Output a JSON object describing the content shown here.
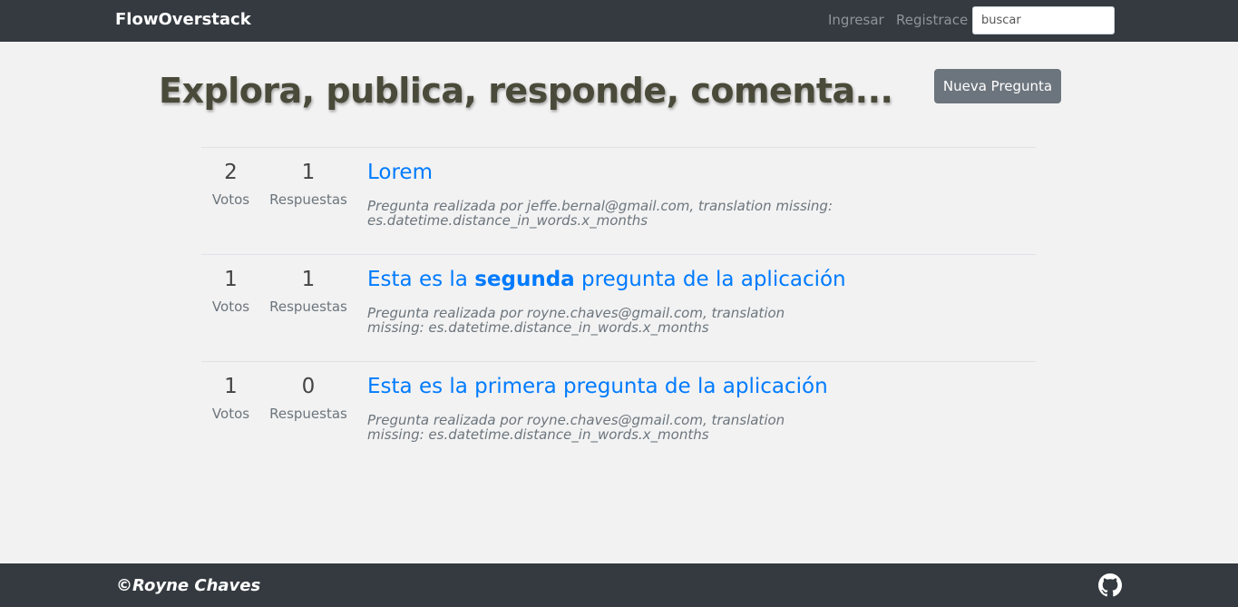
{
  "navbar": {
    "brand": "FlowOverstack",
    "login_label": "Ingresar",
    "register_label": "Registrace",
    "search_placeholder": "buscar"
  },
  "header": {
    "title": "Explora, publica, responde, comenta...",
    "new_question_label": "Nueva Pregunta"
  },
  "stat_labels": {
    "votes": "Votos",
    "answers": "Respuestas"
  },
  "questions": [
    {
      "votes": "2",
      "answers": "1",
      "title_before": "Lorem",
      "title_bold": "",
      "title_after": "",
      "meta": "Pregunta realizada por jeffe.bernal@gmail.com, translation missing: es.datetime.distance_in_words.x_months"
    },
    {
      "votes": "1",
      "answers": "1",
      "title_before": "Esta es la ",
      "title_bold": "segunda",
      "title_after": " pregunta de la aplicación",
      "meta": "Pregunta realizada por royne.chaves@gmail.com, translation missing: es.datetime.distance_in_words.x_months"
    },
    {
      "votes": "1",
      "answers": "0",
      "title_before": "Esta es la primera pregunta de la aplicación",
      "title_bold": "",
      "title_after": "",
      "meta": "Pregunta realizada por royne.chaves@gmail.com, translation missing: es.datetime.distance_in_words.x_months"
    }
  ],
  "footer": {
    "copyright": "©Royne Chaves",
    "icon": "github-icon"
  },
  "colors": {
    "navbar_bg": "#343a40",
    "link": "#007bff",
    "button_bg": "#6c757d",
    "page_bg": "#f2f2f2"
  }
}
